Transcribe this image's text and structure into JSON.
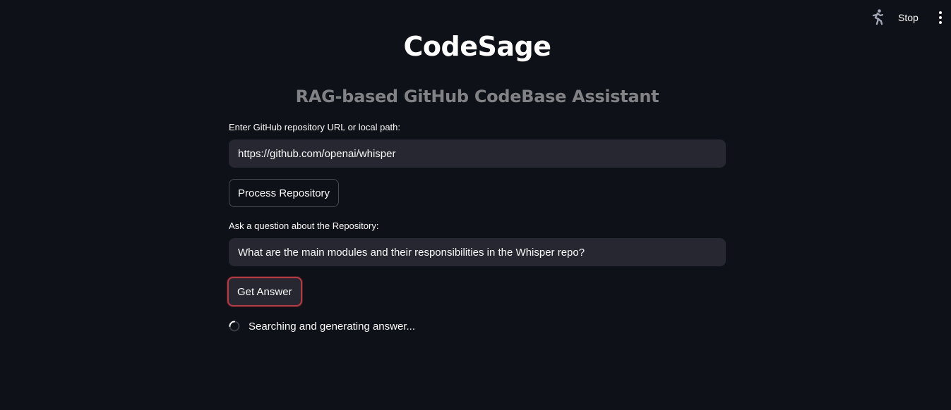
{
  "toolbar": {
    "running_icon": "running-person-icon",
    "stop_label": "Stop",
    "menu_icon": "vertical-ellipsis-icon"
  },
  "header": {
    "title": "CodeSage",
    "subtitle": "RAG-based GitHub CodeBase Assistant"
  },
  "repo": {
    "label": "Enter GitHub repository URL or local path:",
    "value": "https://github.com/openai/whisper",
    "button_label": "Process Repository"
  },
  "question": {
    "label": "Ask a question about the Repository:",
    "value": "What are the main modules and their responsibilities in the Whisper repo?",
    "button_label": "Get Answer"
  },
  "status": {
    "icon": "loading-spinner-icon",
    "text": "Searching and generating answer..."
  },
  "colors": {
    "background": "#0e1117",
    "input_background": "#262730",
    "text": "#fafafa",
    "subtitle": "#808285",
    "focus_border": "#b23b45"
  }
}
